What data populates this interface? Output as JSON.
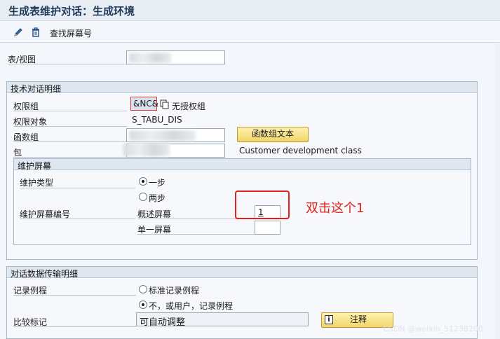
{
  "window": {
    "title": "生成表维护对话：生成环境"
  },
  "toolbar": {
    "find_screen_label": "查找屏幕号"
  },
  "header": {
    "table_view_label": "表/视图"
  },
  "tech_details": {
    "title": "技术对话明细",
    "auth_group_label": "权限组",
    "auth_group_value": "&NC&",
    "auth_group_desc": "无授权组",
    "auth_object_label": "权限对象",
    "auth_object_value": "S_TABU_DIS",
    "function_group_label": "函数组",
    "function_group_button": "函数组文本",
    "package_label": "包",
    "package_desc": "Customer development class"
  },
  "maint_screens": {
    "title": "维护屏幕",
    "type_label": "维护类型",
    "one_step": "一步",
    "two_step": "两步",
    "screen_number_label": "维护屏幕编号",
    "overview_label": "概述屏幕",
    "overview_value": "1",
    "single_label": "单一屏幕",
    "single_value": ""
  },
  "annotation": {
    "text": "双击这个1"
  },
  "data_transfer": {
    "title": "对话数据传输明细",
    "record_routine_label": "记录例程",
    "standard_routine": "标准记录例程",
    "no_routine": "不，或用户，记录例程",
    "compare_flag_label": "比较标记",
    "compare_flag_value": "可自动调整",
    "note_button": "注释"
  },
  "watermark": {
    "text": "CSDN @weixin_51238200"
  },
  "colors": {
    "accent_red": "#e0201a",
    "button_yellow": "#f1d46a"
  }
}
